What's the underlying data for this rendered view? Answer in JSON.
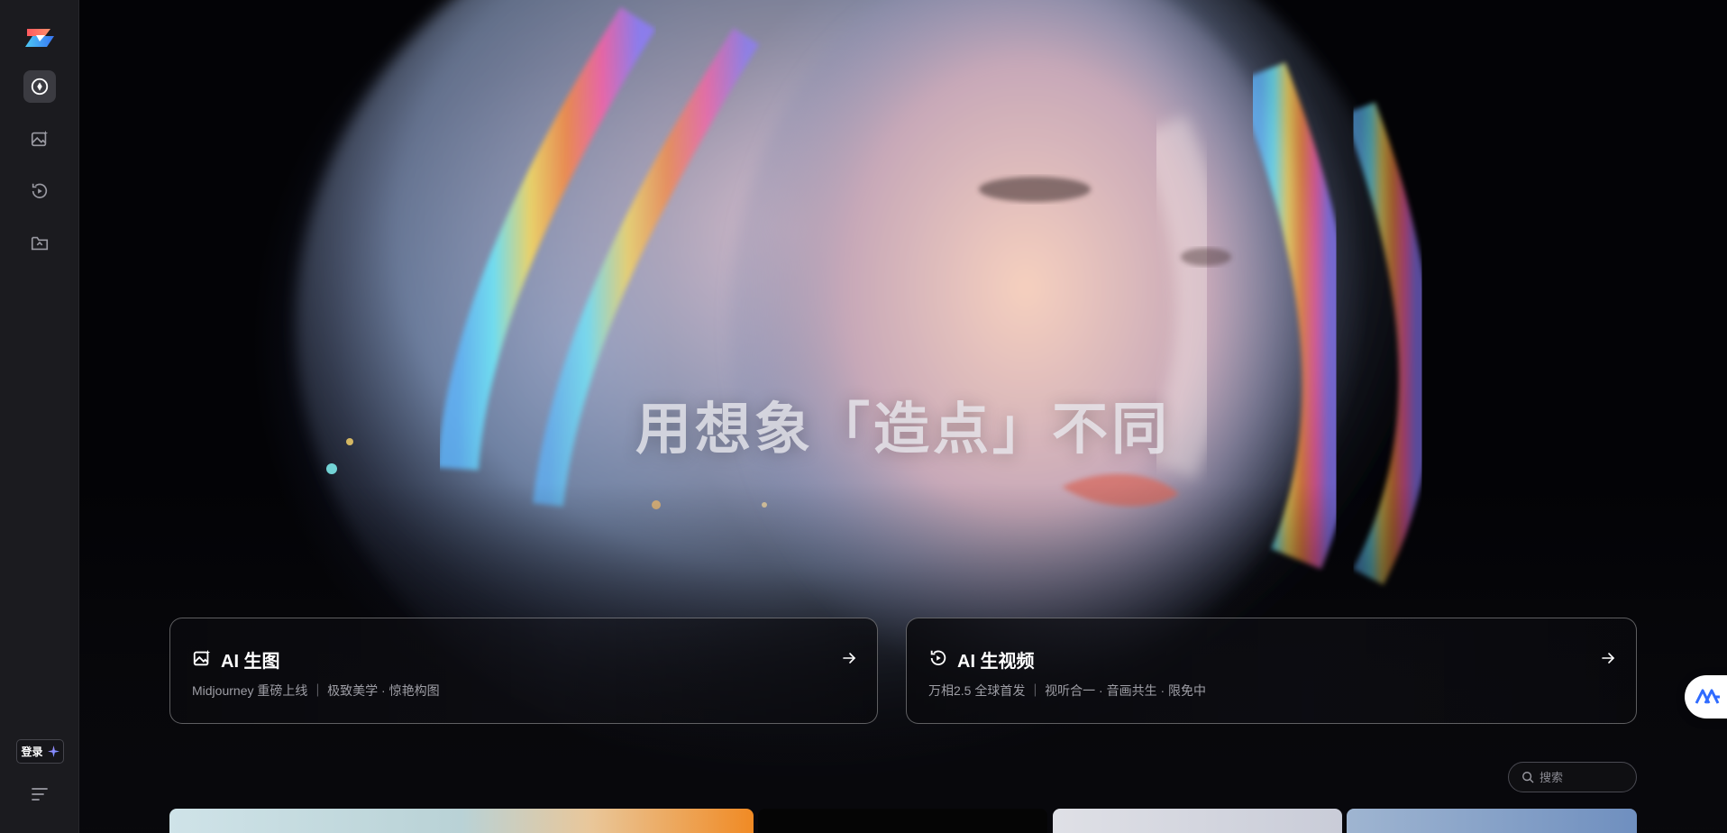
{
  "sidebar": {
    "nav": [
      {
        "name": "explore",
        "icon": "compass-icon",
        "active": true
      },
      {
        "name": "ai-image",
        "icon": "image-sparkle-icon",
        "active": false
      },
      {
        "name": "ai-video",
        "icon": "video-replay-icon",
        "active": false
      },
      {
        "name": "assets",
        "icon": "folder-upload-icon",
        "active": false
      }
    ],
    "login_label": "登录",
    "menu_icon": "menu-lines-icon"
  },
  "hero": {
    "headline": "用想象「造点」不同"
  },
  "cards": [
    {
      "title": "AI 生图",
      "subtitle": "Midjourney 重磅上线 ｜ 极致美学 · 惊艳构图",
      "icon": "image-sparkle-icon"
    },
    {
      "title": "AI 生视频",
      "subtitle": "万相2.5 全球首发 ｜ 视听合一 · 音画共生 · 限免中",
      "icon": "video-replay-icon"
    }
  ],
  "search": {
    "placeholder": "搜索"
  },
  "colors": {
    "accent": "#2f6bff",
    "sidebar_bg": "#1b1b1f",
    "page_bg": "#000000"
  }
}
